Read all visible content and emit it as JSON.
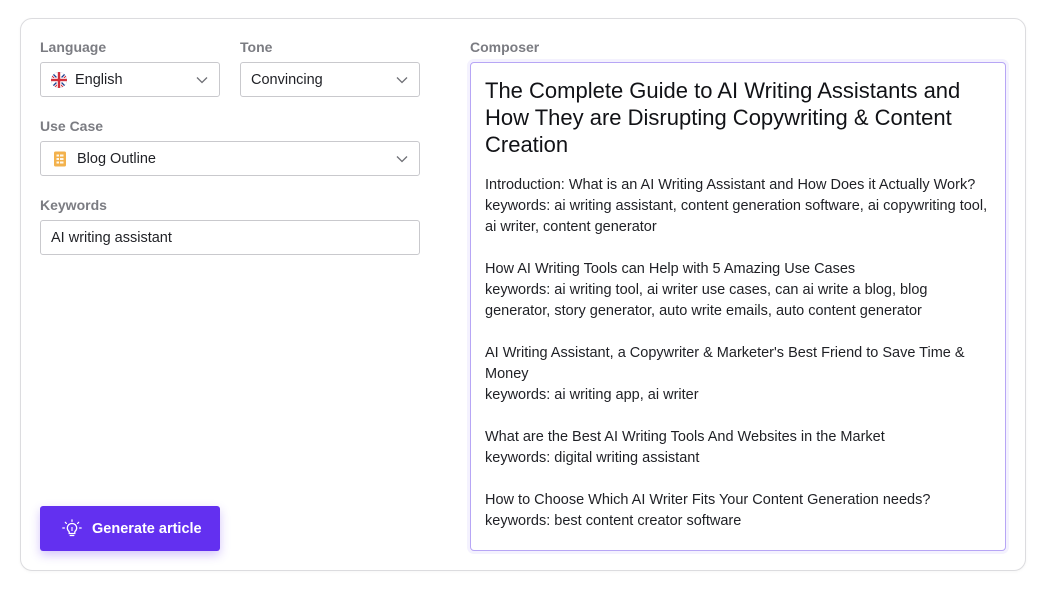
{
  "form": {
    "language": {
      "label": "Language",
      "value": "English",
      "icon": "uk-flag-icon"
    },
    "tone": {
      "label": "Tone",
      "value": "Convincing"
    },
    "use_case": {
      "label": "Use Case",
      "value": "Blog Outline",
      "icon": "document-icon"
    },
    "keywords": {
      "label": "Keywords",
      "value": "AI writing assistant"
    },
    "generate_label": "Generate article"
  },
  "composer": {
    "label": "Composer",
    "title": "The Complete Guide to AI Writing Assistants and How They are Disrupting Copywriting & Content Creation",
    "sections": [
      {
        "heading": "Introduction: What is an AI Writing Assistant and How Does it Actually Work?",
        "keywords": "keywords: ai writing assistant, content generation software, ai copywriting tool, ai writer, content generator"
      },
      {
        "heading": "How AI Writing Tools can Help with 5 Amazing Use Cases",
        "keywords": "keywords: ai writing tool, ai writer use cases, can ai write a blog, blog generator, story generator, auto write emails, auto content generator"
      },
      {
        "heading": "AI Writing Assistant, a Copywriter & Marketer's Best Friend to Save Time & Money",
        "keywords": "keywords: ai writing app, ai writer"
      },
      {
        "heading": "What are the Best AI Writing Tools And Websites in the Market",
        "keywords": "keywords: digital writing assistant"
      },
      {
        "heading": "How to Choose Which AI Writer Fits Your Content Generation needs?",
        "keywords": "keywords: best content creator software"
      }
    ]
  },
  "colors": {
    "accent": "#6330f0",
    "composer_border": "#b7a6f5",
    "label": "#7b7c82"
  }
}
